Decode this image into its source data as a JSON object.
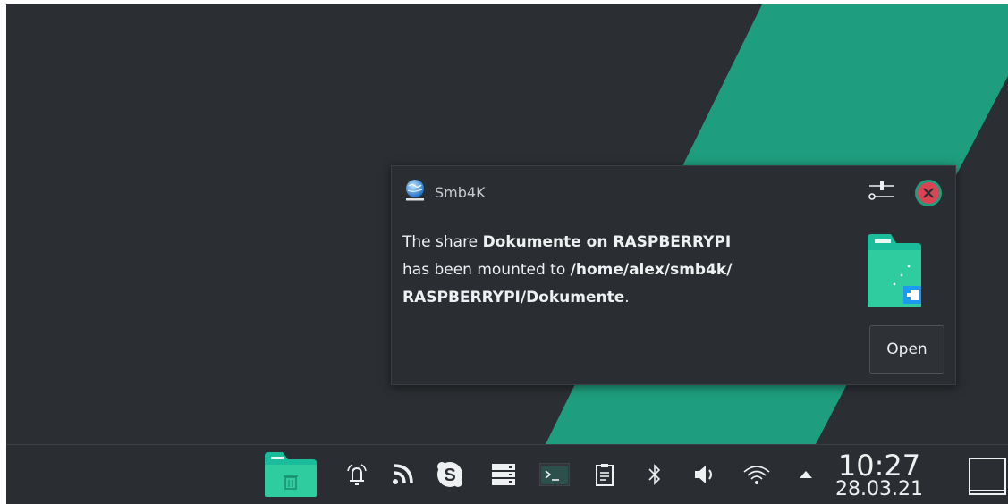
{
  "notification": {
    "app_name": "Smb4K",
    "body": {
      "p1": "The share ",
      "share": "Dokumente on RASPBERRYPI",
      "p2": "has been mounted to ",
      "path1": "/home/alex/smb4k/",
      "path2": "RASPBERRYPI/Dokumente",
      "end": "."
    },
    "action_label": "Open",
    "icons": {
      "app": "smb4k-globe-icon",
      "settings": "settings-sliders-icon",
      "close": "close-icon",
      "image": "folder-remote-network-icon"
    }
  },
  "taskbar": {
    "tray_icons": [
      "trash-folder-icon",
      "alarm-bell-icon",
      "rss-feed-icon",
      "skype-icon",
      "server-storage-icon",
      "terminal-icon",
      "clipboard-icon",
      "bluetooth-icon",
      "volume-icon",
      "wifi-icon",
      "expand-arrow-icon"
    ],
    "clock": {
      "time": "10:27",
      "date": "28.03.21"
    },
    "show_desktop_icon": "show-desktop-icon"
  },
  "colors": {
    "desktop": "#2b2e32",
    "accent_green": "#1e9e7e",
    "notification_bg": "#2a2e32",
    "close_red": "#da4453",
    "text": "#eff0f1"
  }
}
